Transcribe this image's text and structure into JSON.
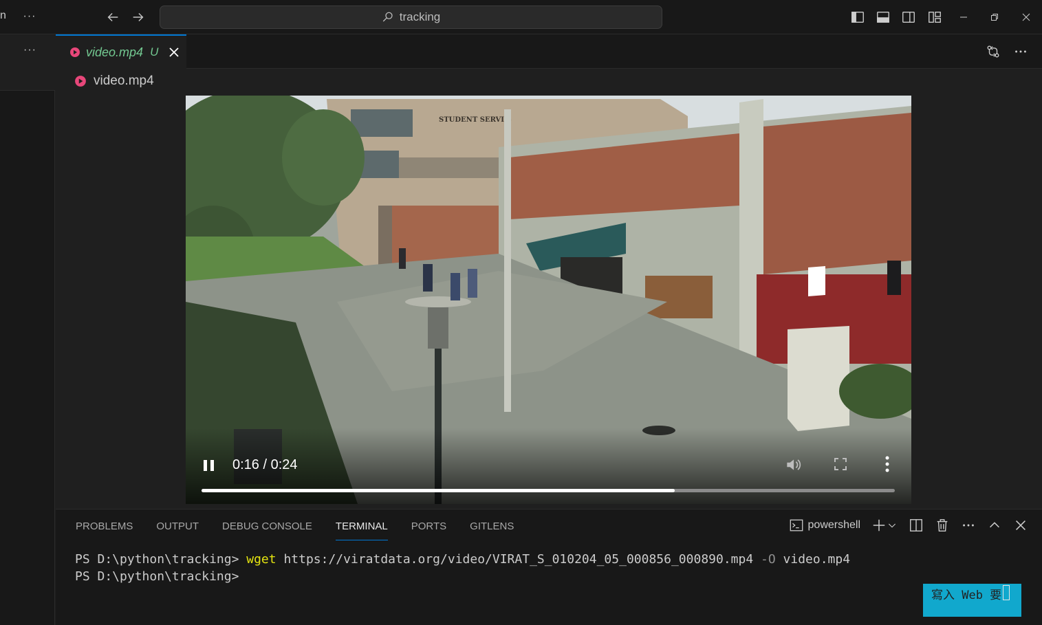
{
  "titlebar": {
    "left_fragment": "n",
    "more_label": "···",
    "search_text": "tracking"
  },
  "sidebar": {
    "more_label": "···"
  },
  "editor": {
    "tab": {
      "name": "video.mp4",
      "status_flag": "U"
    },
    "breadcrumb": "video.mp4"
  },
  "video": {
    "time": "0:16 / 0:24",
    "progress_fraction": 0.683,
    "sign_text": "STUDENT SERVI  S"
  },
  "panel": {
    "tabs": [
      {
        "label": "PROBLEMS"
      },
      {
        "label": "OUTPUT"
      },
      {
        "label": "DEBUG CONSOLE"
      },
      {
        "label": "TERMINAL"
      },
      {
        "label": "PORTS"
      },
      {
        "label": "GITLENS"
      }
    ],
    "active_tab": "TERMINAL",
    "shell_name": "powershell",
    "terminal": {
      "line1_prompt": "PS D:\\python\\tracking> ",
      "line1_cmd": "wget",
      "line1_url": " https://viratdata.org/video/VIRAT_S_010204_05_000856_000890.mp4 ",
      "line1_flag": "-O",
      "line1_out": " video.mp4",
      "line2_prompt": "PS D:\\python\\tracking>"
    },
    "ime_text": "寫入 Web 要"
  },
  "colors": {
    "accent": "#0078d4",
    "modified_green": "#73c991",
    "command_yellow": "#e5e510",
    "ime_blue": "#11a8cd",
    "video_icon_pink": "#e8477a"
  }
}
